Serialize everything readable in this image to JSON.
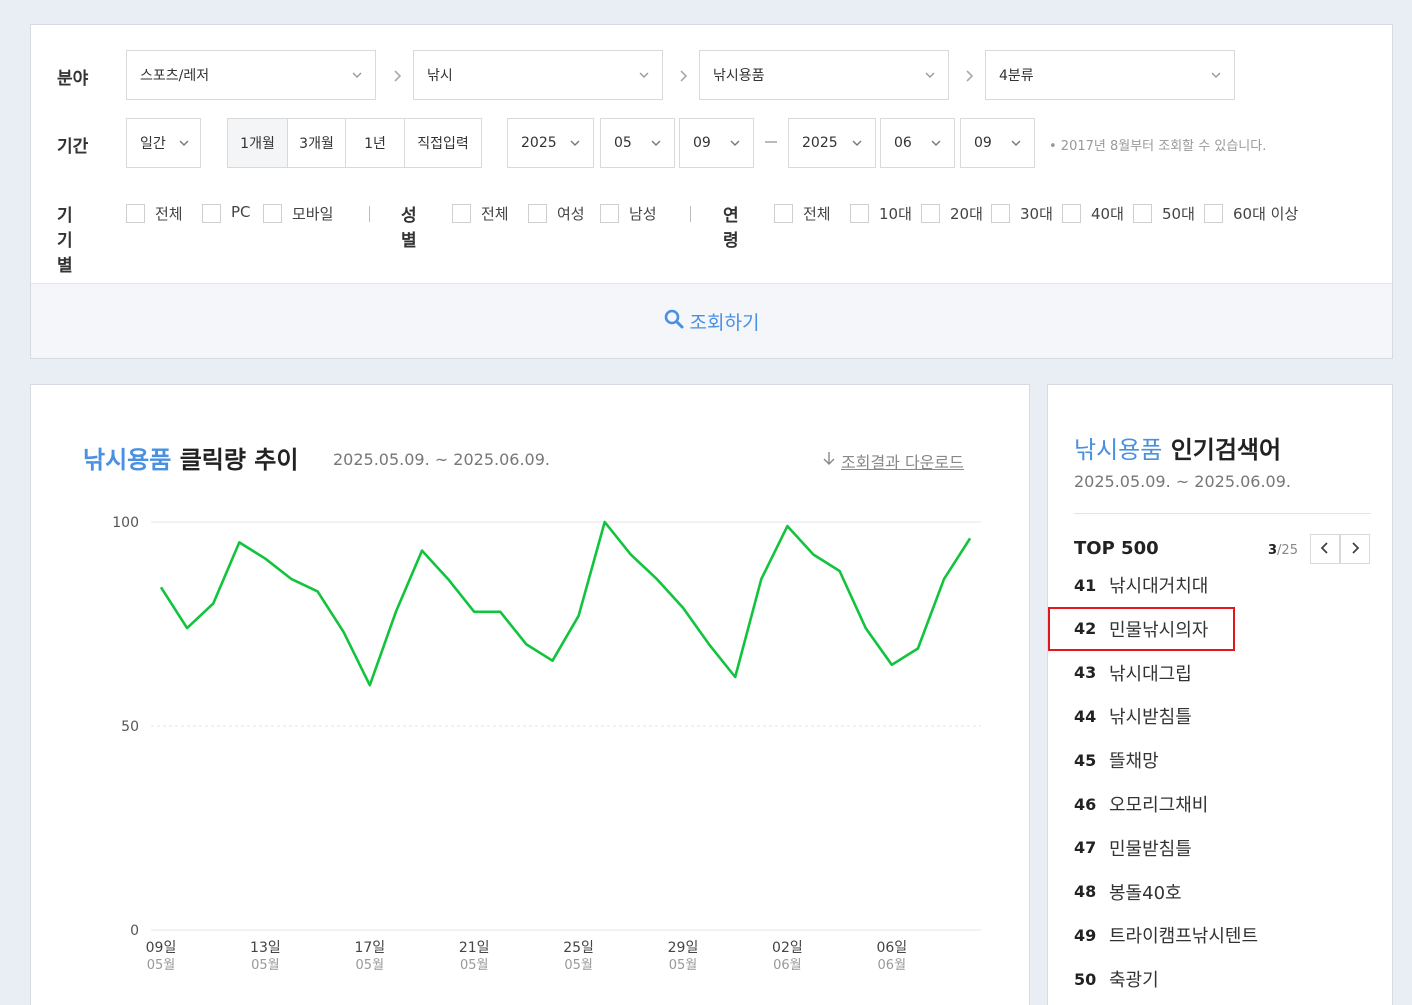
{
  "filter": {
    "category_label": "분야",
    "categories": [
      "스포츠/레저",
      "낚시",
      "낚시용품",
      "4분류"
    ],
    "period_label": "기간",
    "period_unit": "일간",
    "period_options": [
      "1개월",
      "3개월",
      "1년",
      "직접입력"
    ],
    "start": {
      "year": "2025",
      "month": "05",
      "day": "09"
    },
    "end": {
      "year": "2025",
      "month": "06",
      "day": "09"
    },
    "note": "• 2017년 8월부터 조회할 수 있습니다.",
    "device_label": "기기별",
    "device_options": [
      "전체",
      "PC",
      "모바일"
    ],
    "gender_label": "성별",
    "gender_options": [
      "전체",
      "여성",
      "남성"
    ],
    "age_label": "연령",
    "age_options": [
      "전체",
      "10대",
      "20대",
      "30대",
      "40대",
      "50대",
      "60대 이상"
    ],
    "search_label": "조회하기"
  },
  "chart_panel": {
    "title_accent": "낚시용품",
    "title_rest": "클릭량 추이",
    "date_range": "2025.05.09. ~ 2025.06.09.",
    "download_label": "조회결과 다운로드"
  },
  "chart_data": {
    "type": "line",
    "title": "낚시용품 클릭량 추이",
    "x_tick_labels": [
      {
        "day": "09일",
        "month": "05월"
      },
      {
        "day": "13일",
        "month": "05월"
      },
      {
        "day": "17일",
        "month": "05월"
      },
      {
        "day": "21일",
        "month": "05월"
      },
      {
        "day": "25일",
        "month": "05월"
      },
      {
        "day": "29일",
        "month": "05월"
      },
      {
        "day": "02일",
        "month": "06월"
      },
      {
        "day": "06일",
        "month": "06월"
      }
    ],
    "y_ticks": [
      "100",
      "50",
      "0"
    ],
    "ylim": [
      0,
      100
    ],
    "series": [
      {
        "color": "#12c33e",
        "values": [
          84,
          74,
          80,
          95,
          91,
          86,
          83,
          73,
          60,
          78,
          93,
          86,
          78,
          78,
          70,
          66,
          77,
          100,
          92,
          86,
          79,
          70,
          62,
          86,
          99,
          92,
          88,
          74,
          65,
          69,
          86,
          96
        ]
      }
    ]
  },
  "rank_panel": {
    "title_accent": "낚시용품",
    "title_rest": "인기검색어",
    "date_range": "2025.05.09. ~ 2025.06.09.",
    "top_label": "TOP 500",
    "page_current": "3",
    "page_total": "/25",
    "items": [
      {
        "rank": "41",
        "keyword": "낚시대거치대"
      },
      {
        "rank": "42",
        "keyword": "민물낚시의자"
      },
      {
        "rank": "43",
        "keyword": "낚시대그립"
      },
      {
        "rank": "44",
        "keyword": "낚시받침틀"
      },
      {
        "rank": "45",
        "keyword": "뜰채망"
      },
      {
        "rank": "46",
        "keyword": "오모리그채비"
      },
      {
        "rank": "47",
        "keyword": "민물받침틀"
      },
      {
        "rank": "48",
        "keyword": "봉돌40호"
      },
      {
        "rank": "49",
        "keyword": "트라이캠프낚시텐트"
      },
      {
        "rank": "50",
        "keyword": "축광기"
      }
    ]
  },
  "colors": {
    "accent": "#4a90e2",
    "line": "#12c33e",
    "highlight": "#e2161c"
  }
}
